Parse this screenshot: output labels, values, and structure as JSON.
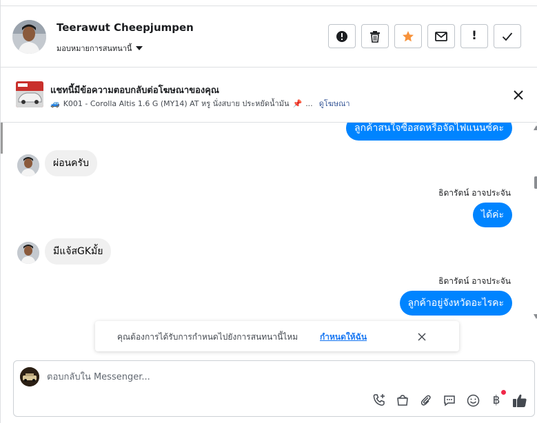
{
  "header": {
    "contact_name": "Teerawut Cheepjumpen",
    "assign_label": "มอบหมายการสนทนานี้",
    "actions": [
      {
        "name": "spam-button",
        "icon": "alert-circle-icon"
      },
      {
        "name": "delete-button",
        "icon": "trash-icon"
      },
      {
        "name": "star-button",
        "icon": "star-icon"
      },
      {
        "name": "mark-unread-button",
        "icon": "envelope-icon"
      },
      {
        "name": "follow-up-button",
        "icon": "exclamation-icon",
        "glyph": "!"
      },
      {
        "name": "mark-done-button",
        "icon": "checkmark-icon"
      }
    ]
  },
  "ad": {
    "title": "แชทนี้มีข้อความตอบกลับต่อโฆษณาของคุณ",
    "car_emoji": "🚙",
    "pin_emoji": "📌",
    "subtitle": "K001 - Corolla Altis 1.6 G (MY14) AT หรู นั่งสบาย ประหยัดน้ำมัน",
    "ellipsis": "...",
    "link": "ดูโฆษณา"
  },
  "messages": {
    "m1": "ลูกค้าสนใจซื้อสดหรือจัดไฟแนนซ์คะ",
    "m2": "ผ่อนครับ",
    "m3_sender": "ธิดารัตน์ อาจประจัน",
    "m3": "ได้ค่ะ",
    "m4": "มีแจ้สGKมั้ย",
    "m5_sender": "ธิดารัตน์ อาจประจัน",
    "m5": "ลูกค้าอยู่จังหวัดอะไรคะ"
  },
  "notice": {
    "text": "คุณต้องการได้รับการกำหนดไปยังการสนทนานี้ไหม",
    "link": "กำหนดให้ฉัน"
  },
  "composer": {
    "placeholder": "ตอบกลับใน Messenger...",
    "baht_glyph": "฿"
  },
  "colors": {
    "accent": "#0084ff",
    "link": "#1877f2",
    "star": "#f7923b",
    "notification": "#f02849",
    "incoming_bubble": "#f0f0f0"
  }
}
